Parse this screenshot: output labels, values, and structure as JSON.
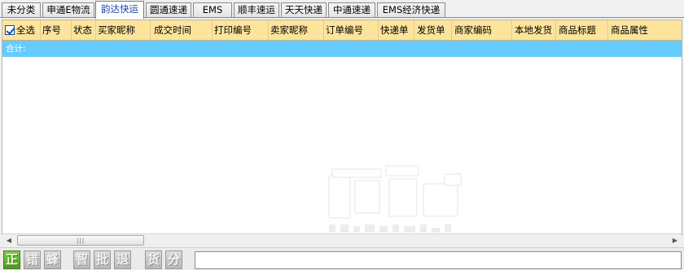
{
  "tabs": [
    {
      "label": "未分类",
      "active": false
    },
    {
      "label": "申通E物流",
      "active": false
    },
    {
      "label": "韵达快运",
      "active": true
    },
    {
      "label": "圆通速递",
      "active": false
    },
    {
      "label": "EMS",
      "active": false
    },
    {
      "label": "顺丰速运",
      "active": false
    },
    {
      "label": "天天快递",
      "active": false
    },
    {
      "label": "中通速递",
      "active": false
    },
    {
      "label": "EMS经济快递",
      "active": false
    }
  ],
  "grid": {
    "select_all_label": "全选",
    "select_all_checked": true,
    "columns": [
      "序号",
      "状态",
      "买家昵称",
      "成交时间",
      "打印编号",
      "卖家昵称",
      "订单编号",
      "快递单",
      "发货单",
      "商家编码",
      "本地发货",
      "商品标题",
      "商品属性"
    ],
    "total_label": "合计:",
    "header_color": "#fde49c",
    "total_row_color": "#66ccff"
  },
  "toolbar": {
    "buttons": [
      {
        "label": "正",
        "accent": "#5aa82c"
      },
      {
        "label": "错"
      },
      {
        "label": "蜂"
      },
      {
        "label": "智"
      },
      {
        "label": "批"
      },
      {
        "label": "退"
      },
      {
        "label": "货"
      },
      {
        "label": "分"
      }
    ],
    "status_value": ""
  }
}
